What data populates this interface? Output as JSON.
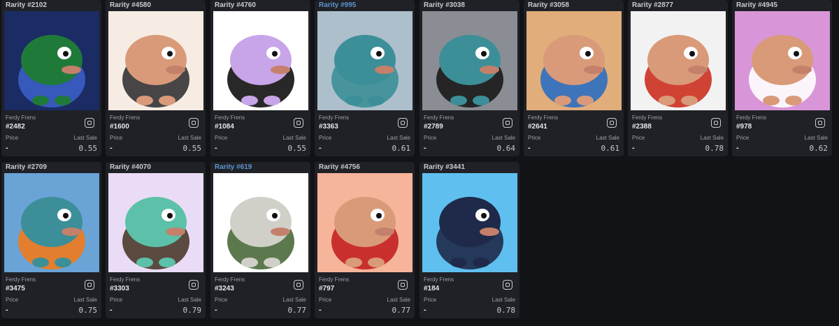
{
  "cards": [
    {
      "rarity": "Rarity #2102",
      "collection": "Ferdy Frens",
      "token": "#2482",
      "price_label": "Price",
      "price": "-",
      "last_sale_label": "Last Sale",
      "last_sale": "0.55",
      "rarity_color": "#c9cbd2",
      "bg": "#1b2b63",
      "body": "#1f7a3a",
      "accent": "#3a5ec4"
    },
    {
      "rarity": "Rarity #4580",
      "collection": "Ferdy Frens",
      "token": "#1600",
      "price_label": "Price",
      "price": "-",
      "last_sale_label": "Last Sale",
      "last_sale": "0.55",
      "rarity_color": "#c9cbd2",
      "bg": "#f7ece4",
      "body": "#d99a79",
      "accent": "#333333"
    },
    {
      "rarity": "Rarity #4760",
      "collection": "Ferdy Frens",
      "token": "#1084",
      "price_label": "Price",
      "price": "-",
      "last_sale_label": "Last Sale",
      "last_sale": "0.55",
      "rarity_color": "#c9cbd2",
      "bg": "#ffffff",
      "body": "#c8a4e8",
      "accent": "#111111"
    },
    {
      "rarity": "Rarity #995",
      "collection": "Ferdy Frens",
      "token": "#3363",
      "price_label": "Price",
      "price": "-",
      "last_sale_label": "Last Sale",
      "last_sale": "0.61",
      "rarity_color": "#5f93d1",
      "bg": "#aebfcc",
      "body": "#3c8f98",
      "accent": "#3c8f98"
    },
    {
      "rarity": "Rarity #3038",
      "collection": "Ferdy Frens",
      "token": "#2789",
      "price_label": "Price",
      "price": "-",
      "last_sale_label": "Last Sale",
      "last_sale": "0.64",
      "rarity_color": "#c9cbd2",
      "bg": "#8a8d93",
      "body": "#3c8f98",
      "accent": "#1a1a1a"
    },
    {
      "rarity": "Rarity #3058",
      "collection": "Ferdy Frens",
      "token": "#2641",
      "price_label": "Price",
      "price": "-",
      "last_sale_label": "Last Sale",
      "last_sale": "0.61",
      "rarity_color": "#c9cbd2",
      "bg": "#e1ad7a",
      "body": "#d99a79",
      "accent": "#2c6ec0"
    },
    {
      "rarity": "Rarity #2877",
      "collection": "Ferdy Frens",
      "token": "#2388",
      "price_label": "Price",
      "price": "-",
      "last_sale_label": "Last Sale",
      "last_sale": "0.78",
      "rarity_color": "#c9cbd2",
      "bg": "#f2f2f2",
      "body": "#d99a79",
      "accent": "#cc2f1f"
    },
    {
      "rarity": "Rarity #4945",
      "collection": "Ferdy Frens",
      "token": "#978",
      "price_label": "Price",
      "price": "-",
      "last_sale_label": "Last Sale",
      "last_sale": "0.62",
      "rarity_color": "#c9cbd2",
      "bg": "#d896d8",
      "body": "#d99a79",
      "accent": "#ffffff"
    },
    {
      "rarity": "Rarity #2709",
      "collection": "Ferdy Frens",
      "token": "#3475",
      "price_label": "Price",
      "price": "-",
      "last_sale_label": "Last Sale",
      "last_sale": "0.75",
      "rarity_color": "#c9cbd2",
      "bg": "#6aa3d6",
      "body": "#3c8f98",
      "accent": "#f07a1c"
    },
    {
      "rarity": "Rarity #4070",
      "collection": "Ferdy Frens",
      "token": "#3303",
      "price_label": "Price",
      "price": "-",
      "last_sale_label": "Last Sale",
      "last_sale": "0.79",
      "rarity_color": "#c9cbd2",
      "bg": "#eadcf6",
      "body": "#5cc1a8",
      "accent": "#4a3a2c"
    },
    {
      "rarity": "Rarity #619",
      "collection": "Ferdy Frens",
      "token": "#3243",
      "price_label": "Price",
      "price": "-",
      "last_sale_label": "Last Sale",
      "last_sale": "0.77",
      "rarity_color": "#5f93d1",
      "bg": "#ffffff",
      "body": "#d0d0c8",
      "accent": "#4a6a3a"
    },
    {
      "rarity": "Rarity #4756",
      "collection": "Ferdy Frens",
      "token": "#797",
      "price_label": "Price",
      "price": "-",
      "last_sale_label": "Last Sale",
      "last_sale": "0.77",
      "rarity_color": "#c9cbd2",
      "bg": "#f6b49a",
      "body": "#d99a79",
      "accent": "#c42121"
    },
    {
      "rarity": "Rarity #3441",
      "collection": "Ferdy Frens",
      "token": "#184",
      "price_label": "Price",
      "price": "-",
      "last_sale_label": "Last Sale",
      "last_sale": "0.78",
      "rarity_color": "#c9cbd2",
      "bg": "#5fc0f0",
      "body": "#1f2a4a",
      "accent": "#1f2a4a"
    }
  ]
}
